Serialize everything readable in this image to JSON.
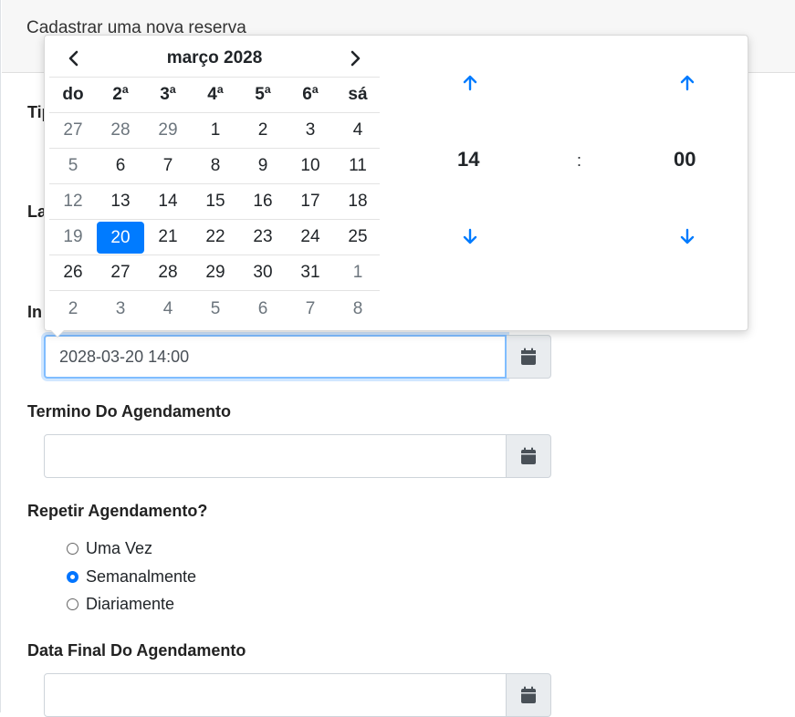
{
  "header": {
    "title": "Cadastrar uma nova reserva"
  },
  "form": {
    "tipo_label_partial": "Tip",
    "local_label_partial": "La",
    "inicio_label_partial": "In",
    "inicio_value": "2028-03-20 14:00",
    "termino_label": "Termino Do Agendamento",
    "termino_value": "",
    "repetir_label": "Repetir Agendamento?",
    "repetir_options": [
      "Uma Vez",
      "Semanalmente",
      "Diariamente"
    ],
    "repetir_selected": "Semanalmente",
    "data_final_label": "Data Final Do Agendamento",
    "data_final_value": ""
  },
  "picker": {
    "month_label": "março 2028",
    "prev_icon": "chevron-left-icon",
    "next_icon": "chevron-right-icon",
    "weekdays": [
      "do",
      "2ª",
      "3ª",
      "4ª",
      "5ª",
      "6ª",
      "sá"
    ],
    "weeks": [
      [
        "27",
        "28",
        "29",
        "1",
        "2",
        "3",
        "4"
      ],
      [
        "5",
        "6",
        "7",
        "8",
        "9",
        "10",
        "11"
      ],
      [
        "12",
        "13",
        "14",
        "15",
        "16",
        "17",
        "18"
      ],
      [
        "19",
        "20",
        "21",
        "22",
        "23",
        "24",
        "25"
      ],
      [
        "26",
        "27",
        "28",
        "29",
        "30",
        "31",
        "1"
      ],
      [
        "2",
        "3",
        "4",
        "5",
        "6",
        "7",
        "8"
      ]
    ],
    "selected_day": "20",
    "hour": "14",
    "separator": ":",
    "minute": "00"
  },
  "colors": {
    "accent": "#007bff",
    "muted_day": "#6c757d",
    "addon_bg": "#e9ecef"
  }
}
